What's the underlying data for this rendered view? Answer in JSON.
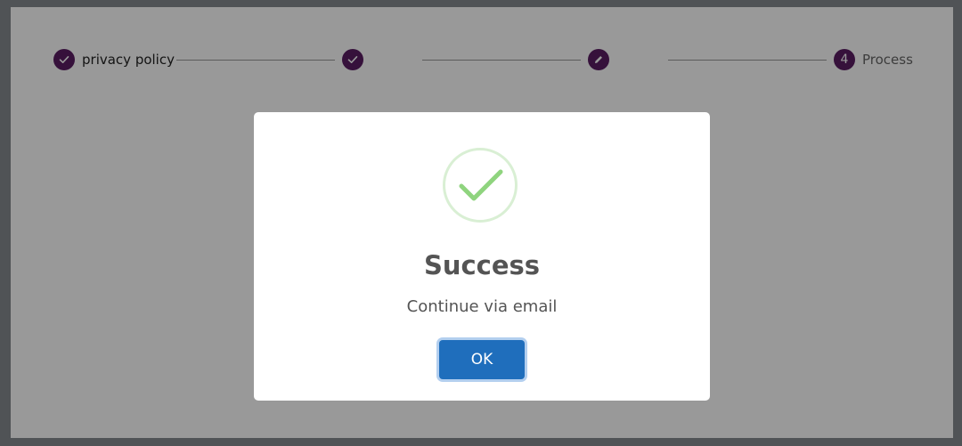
{
  "colors": {
    "step_accent": "#5a1d63",
    "success_green": "#8fd47e",
    "button_blue": "#1f6ebc"
  },
  "stepper": {
    "steps": [
      {
        "number": "",
        "icon": "check-icon",
        "label": "privacy policy",
        "state": "completed"
      },
      {
        "number": "",
        "icon": "check-icon",
        "label": "",
        "state": "completed"
      },
      {
        "number": "",
        "icon": "pencil-icon",
        "label": "",
        "state": "active"
      },
      {
        "number": "4",
        "icon": "",
        "label": "Process",
        "state": "pending"
      }
    ]
  },
  "dialog": {
    "icon": "success-check-icon",
    "title": "Success",
    "text": "Continue via email",
    "ok_label": "OK"
  }
}
